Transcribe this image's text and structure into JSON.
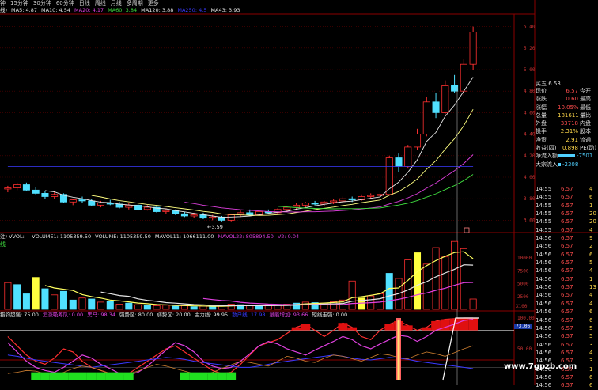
{
  "toolbar": {
    "items": [
      "钟",
      "15分钟",
      "30分钟",
      "60分钟",
      "日线",
      "周线",
      "月线",
      "多周期",
      "更多"
    ]
  },
  "ma_line": {
    "prefix": "线)",
    "items": [
      {
        "text": "MA5: 4.87",
        "color": "#e6e6e6"
      },
      {
        "text": "MA10: 4.54",
        "color": "#e6e6e6"
      },
      {
        "text": "MA20: 4.17",
        "color": "#e040e0"
      },
      {
        "text": "MA60: 3.84",
        "color": "#40e040"
      },
      {
        "text": "MA120: 3.88",
        "color": "#e6e6e6"
      },
      {
        "text": "MA250: 4.5",
        "color": "#3a3aff"
      },
      {
        "text": "MA43: 3.93",
        "color": "#e6e6e6"
      }
    ]
  },
  "price_axis": [
    "5.40",
    "5.20",
    "5.00",
    "4.80",
    "4.60",
    "4.40",
    "4.20",
    "4.00",
    "3.80",
    "3.60"
  ],
  "min_label": "←3.59",
  "vol_header": {
    "items": [
      {
        "text": "注) VVOL: -",
        "color": "#e6e6e6"
      },
      {
        "text": "VOLUME1: 1105359.50",
        "color": "#e6e6e6"
      },
      {
        "text": "VOLUME: 1105359.50",
        "color": "#e6e6e6"
      },
      {
        "text": "MAVOL11: 1066111.00",
        "color": "#e6e6e6"
      },
      {
        "text": "MAVOL22: 805894.50",
        "color": "#e040e0"
      },
      {
        "text": "V2: 0.04",
        "color": "#e040e0"
      }
    ],
    "small": "线"
  },
  "vol_axis": [
    "10000",
    "7500",
    "5000",
    "2500"
  ],
  "vol_unit": "X100",
  "ind_header": {
    "items": [
      {
        "text": "猎钓超强: 75.00",
        "color": "#e6e6e6"
      },
      {
        "text": "追涨吸筹队: 0.00",
        "color": "#e040e0"
      },
      {
        "text": "黑马: 98.34",
        "color": "#e040e0"
      },
      {
        "text": "强势区: 80.00",
        "color": "#e6e6e6"
      },
      {
        "text": "弱势区: 20.00",
        "color": "#e6e6e6"
      },
      {
        "text": "主力线: 99.95",
        "color": "#e6e6e6"
      },
      {
        "text": "散户线: 17.98",
        "color": "#3a3aff"
      },
      {
        "text": "量能增加: 93.66",
        "color": "#e040e0"
      },
      {
        "text": "短线走强: 0.00",
        "color": "#e6e6e6"
      }
    ]
  },
  "ind_axis": [
    "100.00",
    "50.00"
  ],
  "ind_badge": "73.06",
  "quote": {
    "header": "买五    6.53",
    "rows": [
      {
        "k": "现价",
        "v": "6.57",
        "k2": "今开",
        "vc": "#ff4d4d"
      },
      {
        "k": "涨跌",
        "v": "0.60",
        "k2": "最高",
        "vc": "#ff4d4d"
      },
      {
        "k": "涨幅",
        "v": "10.05%",
        "k2": "最低",
        "vc": "#ff4d4d"
      },
      {
        "k": "总量",
        "v": "181611",
        "k2": "量比",
        "vc": "#ffd84a"
      },
      {
        "k": "外盘",
        "v": "33718",
        "k2": "内盘",
        "vc": "#ff4d4d"
      },
      {
        "k": "换手",
        "v": "2.31%",
        "k2": "股本",
        "vc": "#ffd84a"
      },
      {
        "k": "净资",
        "v": "2.91",
        "k2": "流通",
        "vc": "#ffd84a"
      },
      {
        "k": "收益(四)",
        "v": "0.898",
        "k2": "PE(动)",
        "vc": "#ffd84a"
      },
      {
        "k": "净流入额",
        "v": "-7501",
        "k2": "",
        "vc": "#50d0ff"
      },
      {
        "k": "大宗流入",
        "v": "-2308",
        "k2": "",
        "vc": "#50d0ff"
      }
    ]
  },
  "ticks": [
    {
      "t": "14:55",
      "p": "6.57",
      "q": "4"
    },
    {
      "t": "14:55",
      "p": "6.57",
      "q": "6"
    },
    {
      "t": "14:55",
      "p": "6.57",
      "q": "1"
    },
    {
      "t": "14:55",
      "p": "6.57",
      "q": "20"
    },
    {
      "t": "14:55",
      "p": "6.57",
      "q": "20"
    },
    {
      "t": "14:55",
      "p": "6.57",
      "q": "4"
    },
    {
      "t": "14:56",
      "p": "6.57",
      "q": "9"
    },
    {
      "t": "14:56",
      "p": "6.57",
      "q": "2"
    },
    {
      "t": "14:56",
      "p": "6.57",
      "q": "6"
    },
    {
      "t": "14:56",
      "p": "6.57",
      "q": "5"
    },
    {
      "t": "14:56",
      "p": "6.57",
      "q": "4"
    },
    {
      "t": "14:56",
      "p": "6.57",
      "q": "1"
    },
    {
      "t": "14:56",
      "p": "6.57",
      "q": "13"
    },
    {
      "t": "14:56",
      "p": "6.57",
      "q": "4"
    },
    {
      "t": "14:56",
      "p": "6.57",
      "q": "4"
    },
    {
      "t": "14:56",
      "p": "6.57",
      "q": "6"
    },
    {
      "t": "14:56",
      "p": "6.57",
      "q": "6"
    },
    {
      "t": "14:56",
      "p": "6.57",
      "q": "5"
    },
    {
      "t": "14:56",
      "p": "6.57",
      "q": "5"
    },
    {
      "t": "14:56",
      "p": "6.57",
      "q": "3"
    },
    {
      "t": "14:56",
      "p": "6.57",
      "q": "4"
    },
    {
      "t": "14:56",
      "p": "6.57",
      "q": "3"
    },
    {
      "t": "14:56",
      "p": "6.57",
      "q": "1"
    },
    {
      "t": "14:56",
      "p": "6.57",
      "q": "6"
    },
    {
      "t": "14:56",
      "p": "6.57",
      "q": "6"
    }
  ],
  "watermark": "www.7gpzb.com",
  "colors": {
    "up": "#ff3030",
    "down": "#50e0ff",
    "accent": "#ffff40",
    "ma20": "#e040e0",
    "ma60": "#40e040",
    "ma250": "#3a3aff"
  },
  "chart_data": {
    "type": "candlestick",
    "candles": [
      [
        3.89,
        3.92,
        3.86,
        3.9
      ],
      [
        3.9,
        3.95,
        3.88,
        3.93
      ],
      [
        3.93,
        3.95,
        3.87,
        3.88
      ],
      [
        3.88,
        3.91,
        3.84,
        3.85
      ],
      [
        3.85,
        3.87,
        3.8,
        3.82
      ],
      [
        3.82,
        3.86,
        3.8,
        3.84
      ],
      [
        3.84,
        3.85,
        3.76,
        3.77
      ],
      [
        3.77,
        3.8,
        3.74,
        3.79
      ],
      [
        3.79,
        3.82,
        3.76,
        3.78
      ],
      [
        3.78,
        3.8,
        3.73,
        3.74
      ],
      [
        3.74,
        3.78,
        3.72,
        3.76
      ],
      [
        3.76,
        3.79,
        3.74,
        3.75
      ],
      [
        3.75,
        3.77,
        3.71,
        3.72
      ],
      [
        3.72,
        3.76,
        3.7,
        3.74
      ],
      [
        3.74,
        3.75,
        3.69,
        3.7
      ],
      [
        3.7,
        3.74,
        3.69,
        3.72
      ],
      [
        3.72,
        3.73,
        3.67,
        3.68
      ],
      [
        3.68,
        3.71,
        3.66,
        3.69
      ],
      [
        3.69,
        3.7,
        3.65,
        3.66
      ],
      [
        3.66,
        3.68,
        3.63,
        3.64
      ],
      [
        3.64,
        3.67,
        3.62,
        3.65
      ],
      [
        3.65,
        3.67,
        3.61,
        3.62
      ],
      [
        3.62,
        3.65,
        3.6,
        3.63
      ],
      [
        3.63,
        3.64,
        3.59,
        3.6
      ],
      [
        3.6,
        3.66,
        3.59,
        3.65
      ],
      [
        3.65,
        3.69,
        3.63,
        3.67
      ],
      [
        3.67,
        3.7,
        3.64,
        3.65
      ],
      [
        3.65,
        3.69,
        3.64,
        3.68
      ],
      [
        3.68,
        3.7,
        3.66,
        3.67
      ],
      [
        3.67,
        3.71,
        3.66,
        3.7
      ],
      [
        3.7,
        3.73,
        3.68,
        3.72
      ],
      [
        3.72,
        3.76,
        3.7,
        3.74
      ],
      [
        3.74,
        3.77,
        3.72,
        3.76
      ],
      [
        3.76,
        3.78,
        3.74,
        3.75
      ],
      [
        3.75,
        3.78,
        3.73,
        3.77
      ],
      [
        3.77,
        3.8,
        3.75,
        3.78
      ],
      [
        3.78,
        3.82,
        3.76,
        3.8
      ],
      [
        3.8,
        3.82,
        3.77,
        3.79
      ],
      [
        3.79,
        3.84,
        3.78,
        3.82
      ],
      [
        3.82,
        3.85,
        3.8,
        3.83
      ],
      [
        3.83,
        3.86,
        3.81,
        3.84
      ],
      [
        3.84,
        4.2,
        3.83,
        4.18
      ],
      [
        4.18,
        4.22,
        4.05,
        4.1
      ],
      [
        4.1,
        4.3,
        4.08,
        4.28
      ],
      [
        4.28,
        4.45,
        4.25,
        4.4
      ],
      [
        4.4,
        4.75,
        4.38,
        4.7
      ],
      [
        4.7,
        4.78,
        4.55,
        4.6
      ],
      [
        4.6,
        4.9,
        4.58,
        4.85
      ],
      [
        4.85,
        4.95,
        4.78,
        4.8
      ],
      [
        4.8,
        5.1,
        4.76,
        5.05
      ],
      [
        5.05,
        5.4,
        5.0,
        5.35
      ]
    ],
    "volume": [
      [
        52,
        0
      ],
      [
        48,
        1
      ],
      [
        30,
        1
      ],
      [
        62,
        0
      ],
      [
        40,
        1
      ],
      [
        28,
        0
      ],
      [
        35,
        1
      ],
      [
        18,
        1
      ],
      [
        22,
        0
      ],
      [
        20,
        1
      ],
      [
        14,
        0
      ],
      [
        16,
        1
      ],
      [
        10,
        0
      ],
      [
        12,
        1
      ],
      [
        9,
        0
      ],
      [
        8,
        1
      ],
      [
        7,
        0
      ],
      [
        8,
        0
      ],
      [
        6,
        1
      ],
      [
        7,
        0
      ],
      [
        5,
        1
      ],
      [
        6,
        0
      ],
      [
        5,
        1
      ],
      [
        6,
        0
      ],
      [
        10,
        0
      ],
      [
        9,
        1
      ],
      [
        8,
        0
      ],
      [
        7,
        1
      ],
      [
        9,
        0
      ],
      [
        8,
        0
      ],
      [
        10,
        0
      ],
      [
        12,
        1
      ],
      [
        14,
        0
      ],
      [
        13,
        1
      ],
      [
        12,
        0
      ],
      [
        15,
        0
      ],
      [
        18,
        0
      ],
      [
        55,
        0
      ],
      [
        22,
        1
      ],
      [
        26,
        0
      ],
      [
        30,
        0
      ],
      [
        70,
        1
      ],
      [
        60,
        0
      ],
      [
        96,
        0
      ],
      [
        110,
        0
      ],
      [
        88,
        0
      ],
      [
        120,
        0
      ],
      [
        102,
        0
      ],
      [
        132,
        0
      ],
      [
        118,
        0
      ],
      [
        20,
        0
      ]
    ]
  }
}
